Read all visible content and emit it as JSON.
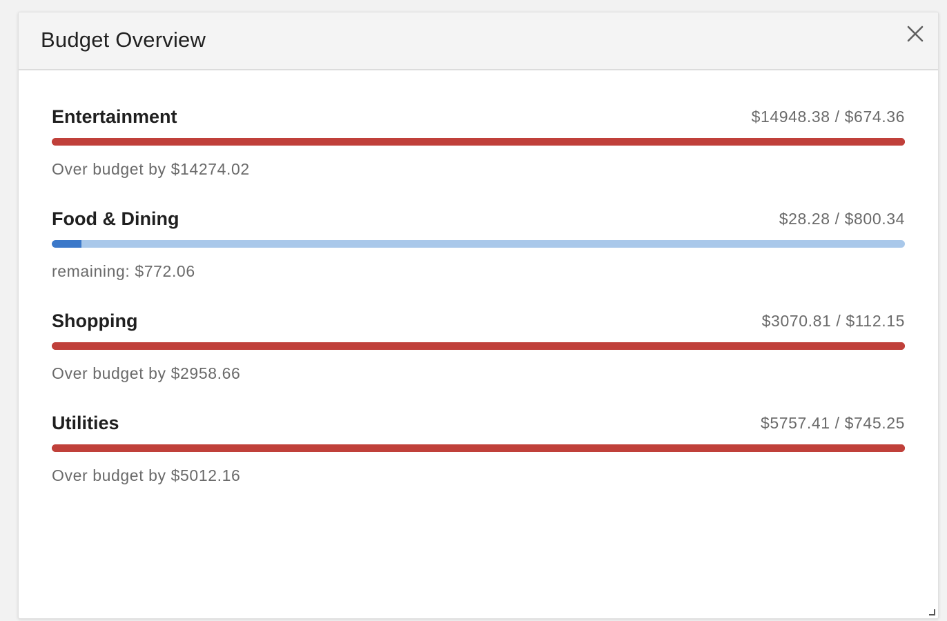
{
  "dialog": {
    "title": "Budget Overview",
    "close_icon": "close-icon"
  },
  "colors": {
    "over_budget": "#c0403a",
    "under_budget_fill": "#3b78c9",
    "under_budget_track": "#a9c8ea"
  },
  "budgets": [
    {
      "name": "Entertainment",
      "amount": "$14948.38 / $674.36",
      "status": "Over budget by $14274.02",
      "over": true,
      "progress": 1.0
    },
    {
      "name": "Food & Dining",
      "amount": "$28.28 / $800.34",
      "status": "remaining: $772.06",
      "over": false,
      "progress": 0.035
    },
    {
      "name": "Shopping",
      "amount": "$3070.81 / $112.15",
      "status": "Over budget by $2958.66",
      "over": true,
      "progress": 1.0
    },
    {
      "name": "Utilities",
      "amount": "$5757.41 / $745.25",
      "status": "Over budget by $5012.16",
      "over": true,
      "progress": 1.0
    }
  ]
}
